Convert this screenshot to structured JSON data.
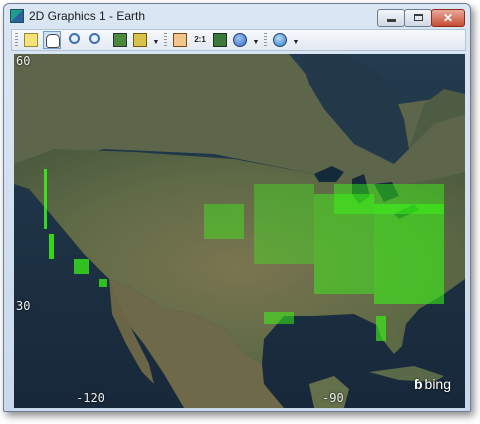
{
  "window": {
    "title": "2D Graphics 1 - Earth",
    "close_glyph": "✕"
  },
  "toolbar": {
    "buttons": [
      {
        "name": "properties-icon",
        "color": "#e8d35a"
      },
      {
        "name": "pan-hand-icon",
        "color": "#6a6f7a",
        "active": true
      },
      {
        "name": "zoom-in-icon",
        "color": "#3f6fb5"
      },
      {
        "name": "zoom-out-icon",
        "color": "#3f6fb5"
      },
      {
        "name": "map-view-icon",
        "color": "#4a8a3a"
      },
      {
        "name": "layers-icon",
        "color": "#d8c24a"
      },
      {
        "name": "scale-icon",
        "color": "#c97b3a"
      },
      {
        "name": "ratio-2-1-icon",
        "color": "#444444"
      },
      {
        "name": "tiles-icon",
        "color": "#3c7a3c"
      },
      {
        "name": "globe-icon",
        "color": "#3a6cc9"
      },
      {
        "name": "web-globe-icon",
        "color": "#2f7bc9"
      }
    ],
    "ratio_label": "2:1"
  },
  "map": {
    "lat_labels": [
      "60",
      "30"
    ],
    "lon_labels": [
      "-120",
      "-90"
    ],
    "attribution": "bing",
    "ocean_color": "#1d3242",
    "land_color": "#6d6a4c",
    "point_color": "#39ff14"
  }
}
